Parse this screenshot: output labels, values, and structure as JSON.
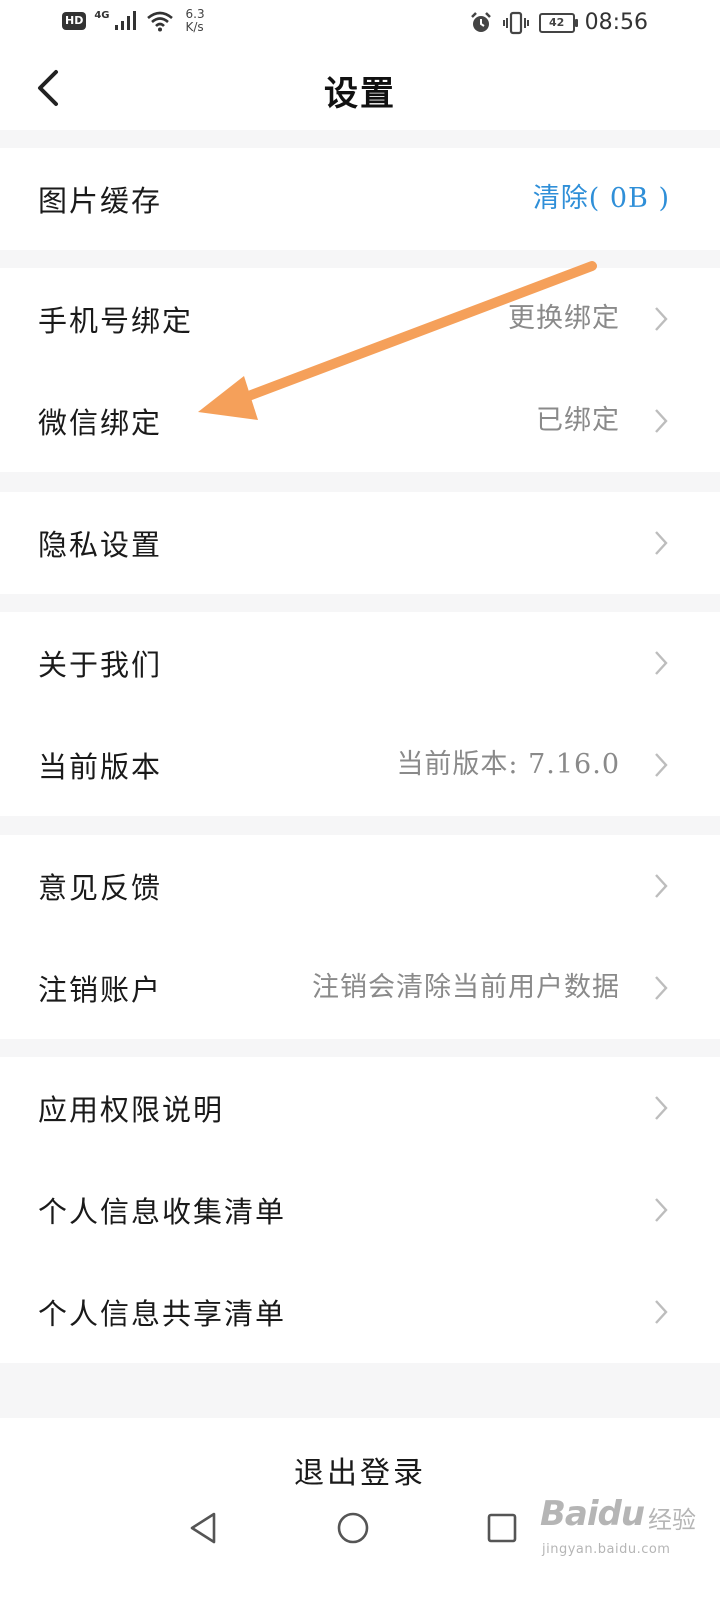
{
  "status_bar": {
    "hd": "HD",
    "network": "4G",
    "speed_value": "6.3",
    "speed_unit": "K/s",
    "battery": "42",
    "time": "08:56"
  },
  "nav": {
    "title": "设置",
    "back_icon": "chevron-left-icon"
  },
  "sections": [
    {
      "rows": [
        {
          "label": "图片缓存",
          "value": "清除( 0B )"
        }
      ]
    },
    {
      "rows": [
        {
          "label": "手机号绑定",
          "value": "更换绑定"
        },
        {
          "label": "微信绑定",
          "value": "已绑定"
        }
      ]
    },
    {
      "rows": [
        {
          "label": "隐私设置",
          "value": ""
        }
      ]
    },
    {
      "rows": [
        {
          "label": "关于我们",
          "value": ""
        },
        {
          "label": "当前版本",
          "value": "当前版本: 7.16.0"
        }
      ]
    },
    {
      "rows": [
        {
          "label": "意见反馈",
          "value": ""
        },
        {
          "label": "注销账户",
          "value": "注销会清除当前用户数据"
        }
      ]
    },
    {
      "rows": [
        {
          "label": "应用权限说明",
          "value": ""
        },
        {
          "label": "个人信息收集清单",
          "value": ""
        },
        {
          "label": "个人信息共享清单",
          "value": ""
        }
      ]
    }
  ],
  "logout_label": "退出登录",
  "system_nav": {
    "back": "triangle-back-icon",
    "home": "circle-home-icon",
    "recents": "square-recents-icon"
  },
  "watermark": {
    "brand": "Baidu",
    "brand_cn": "经验",
    "url": "jingyan.baidu.com"
  },
  "colors": {
    "accent_blue": "#2f8fd8",
    "annotation_arrow": "#f5a05a",
    "secondary_text": "#8a8a8a",
    "background": "#f6f6f7"
  }
}
